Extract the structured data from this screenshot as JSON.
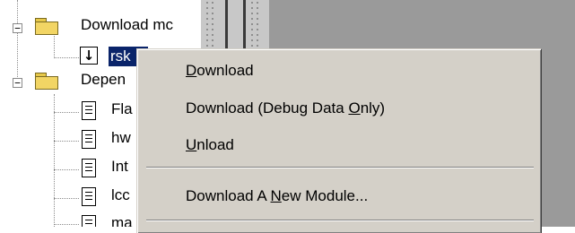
{
  "tree": {
    "download_modules": {
      "label": "Download mc",
      "expander": "−"
    },
    "module_item": {
      "label": "rsk"
    },
    "dependencies": {
      "label": "Depen",
      "expander": "−"
    },
    "dependency_items": [
      "Fla",
      "hw",
      "Int",
      "lcc",
      "ma"
    ]
  },
  "context_menu": {
    "items": [
      {
        "pre": "",
        "accel": "D",
        "post": "ownload"
      },
      {
        "pre": "Download (Debug Data ",
        "accel": "O",
        "post": "nly)"
      },
      {
        "pre": "",
        "accel": "U",
        "post": "nload"
      },
      {
        "pre": "Download A ",
        "accel": "N",
        "post": "ew Module..."
      }
    ]
  },
  "icons": {
    "download_item": "download-arrow-icon",
    "folder": "folder-icon",
    "document": "document-icon"
  }
}
